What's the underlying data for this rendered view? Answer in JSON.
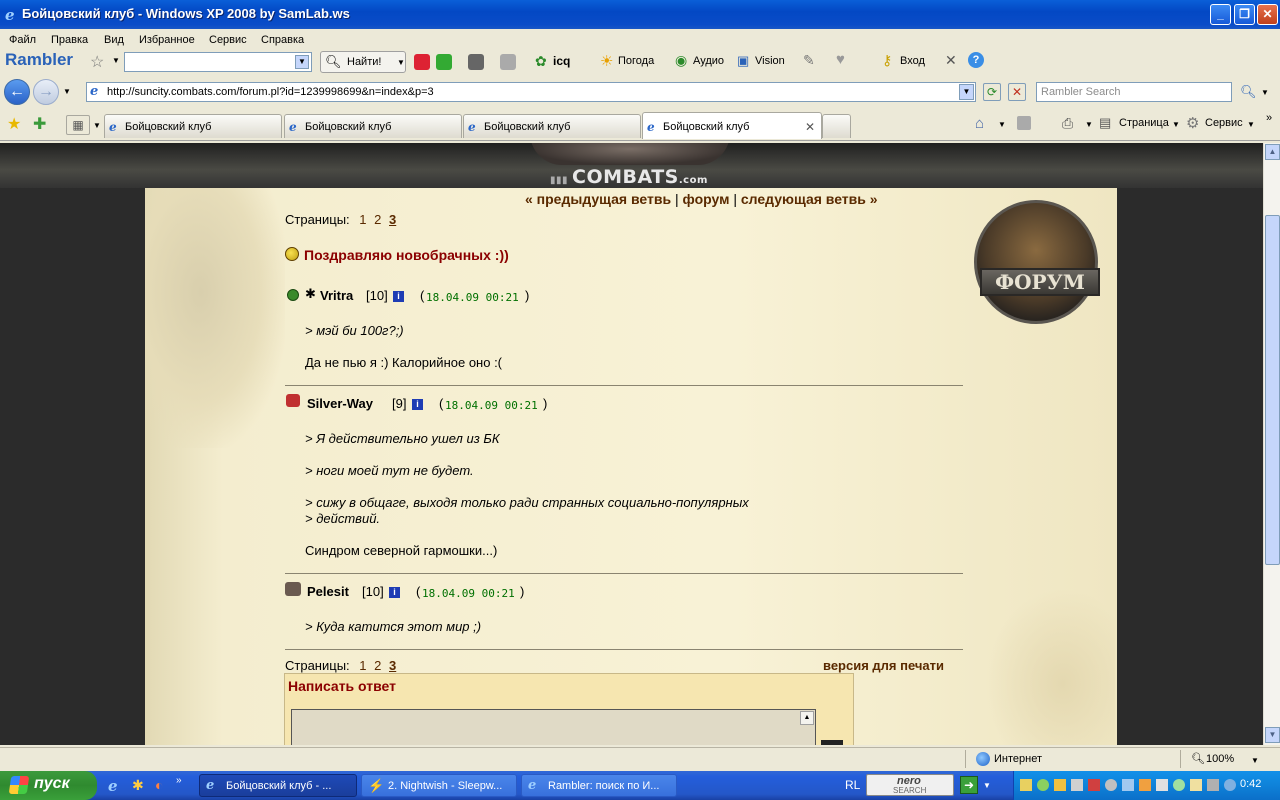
{
  "window": {
    "title": "Бойцовский клуб - Windows XP 2008 by SamLab.ws",
    "min_label": "_",
    "max_label": "❐",
    "close_label": "✕"
  },
  "menu": [
    "Файл",
    "Правка",
    "Вид",
    "Избранное",
    "Сервис",
    "Справка"
  ],
  "rambler_toolbar": {
    "brand": "Rambler",
    "find_label": "Найти!",
    "icq_label": "icq",
    "weather_label": "Погода",
    "audio_label": "Аудио",
    "vision_label": "Vision",
    "login_label": "Вход"
  },
  "address": {
    "url": "http://suncity.combats.com/forum.pl?id=1239998699&n=index&p=3",
    "search_placeholder": "Rambler Search"
  },
  "tabs": [
    {
      "label": "Бойцовский клуб"
    },
    {
      "label": "Бойцовский клуб"
    },
    {
      "label": "Бойцовский клуб"
    },
    {
      "label": "Бойцовский клуб",
      "active": true
    }
  ],
  "tab_tools": {
    "page_label": "Страница",
    "service_label": "Сервис"
  },
  "forum": {
    "logo_text": "COMBATS",
    "logo_suffix": ".com",
    "forum_badge": "ФОРУМ",
    "pages_label": "Страницы:",
    "pages": [
      "1",
      "2",
      "3"
    ],
    "current_page": "3",
    "prev_branch": "« предыдущая ветвь",
    "forum_link": "форум",
    "next_branch": "следующая ветвь »",
    "divider": "|",
    "topic_title": "Поздравляю новобрачных :))",
    "print_version": "версия для печати",
    "reply_title": "Написать ответ",
    "posts": [
      {
        "author": "Vritra",
        "level": "[10]",
        "date": "18.04.09 00:21",
        "lines": [
          {
            "text": "> мэй би 100г?;)",
            "quote": true
          },
          {
            "text": "Да не пью я :) Калорийное оно :(",
            "quote": false
          }
        ]
      },
      {
        "author": "Silver-Way",
        "level": "[9]",
        "date": "18.04.09 00:21",
        "lines": [
          {
            "text": "> Я действительно ушел из БК",
            "quote": true
          },
          {
            "text": "> ноги моей тут не будет.",
            "quote": true
          },
          {
            "text": "> сижу в общаге, выходя только ради странных социально-популярных",
            "quote": true
          },
          {
            "text": "> действий.",
            "quote": true
          },
          {
            "text": "Синдром северной гармошки...)",
            "quote": false
          }
        ]
      },
      {
        "author": "Pelesit",
        "level": "[10]",
        "date": "18.04.09 00:21",
        "lines": [
          {
            "text": "> Куда катится этот мир ;)",
            "quote": true
          }
        ]
      }
    ]
  },
  "statusbar": {
    "zone": "Интернет",
    "zoom": "100%"
  },
  "taskbar": {
    "start_label": "пуск",
    "tasks": [
      {
        "label": "Бойцовский клуб - ..."
      },
      {
        "label": "2. Nightwish - Sleepw..."
      },
      {
        "label": "Rambler: поиск по И..."
      }
    ],
    "lang": "RL",
    "nero_label": "nero",
    "nero_sub": "SEARCH",
    "clock": "0:42"
  }
}
